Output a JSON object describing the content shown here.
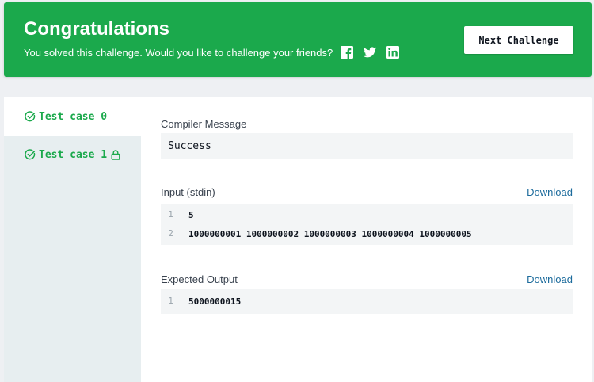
{
  "banner": {
    "title": "Congratulations",
    "subtitle": "You solved this challenge. Would you like to challenge your friends?",
    "social_icons": [
      "facebook-icon",
      "twitter-icon",
      "linkedin-icon"
    ],
    "next_button": "Next Challenge",
    "color": "#1ba94c"
  },
  "tabs": [
    {
      "label": "Test case 0",
      "status": "passed",
      "locked": false,
      "active": true
    },
    {
      "label": "Test case 1",
      "status": "passed",
      "locked": true,
      "active": false
    }
  ],
  "compiler": {
    "label": "Compiler Message",
    "message": "Success"
  },
  "input": {
    "label": "Input (stdin)",
    "download": "Download",
    "lines": [
      {
        "num": "1",
        "text": "5"
      },
      {
        "num": "2",
        "text": "1000000001 1000000002 1000000003 1000000004 1000000005"
      }
    ]
  },
  "expected": {
    "label": "Expected Output",
    "download": "Download",
    "lines": [
      {
        "num": "1",
        "text": "5000000015"
      }
    ]
  },
  "colors": {
    "accent": "#1ba94c",
    "link": "#1c6b9c",
    "text": "#39424e"
  }
}
